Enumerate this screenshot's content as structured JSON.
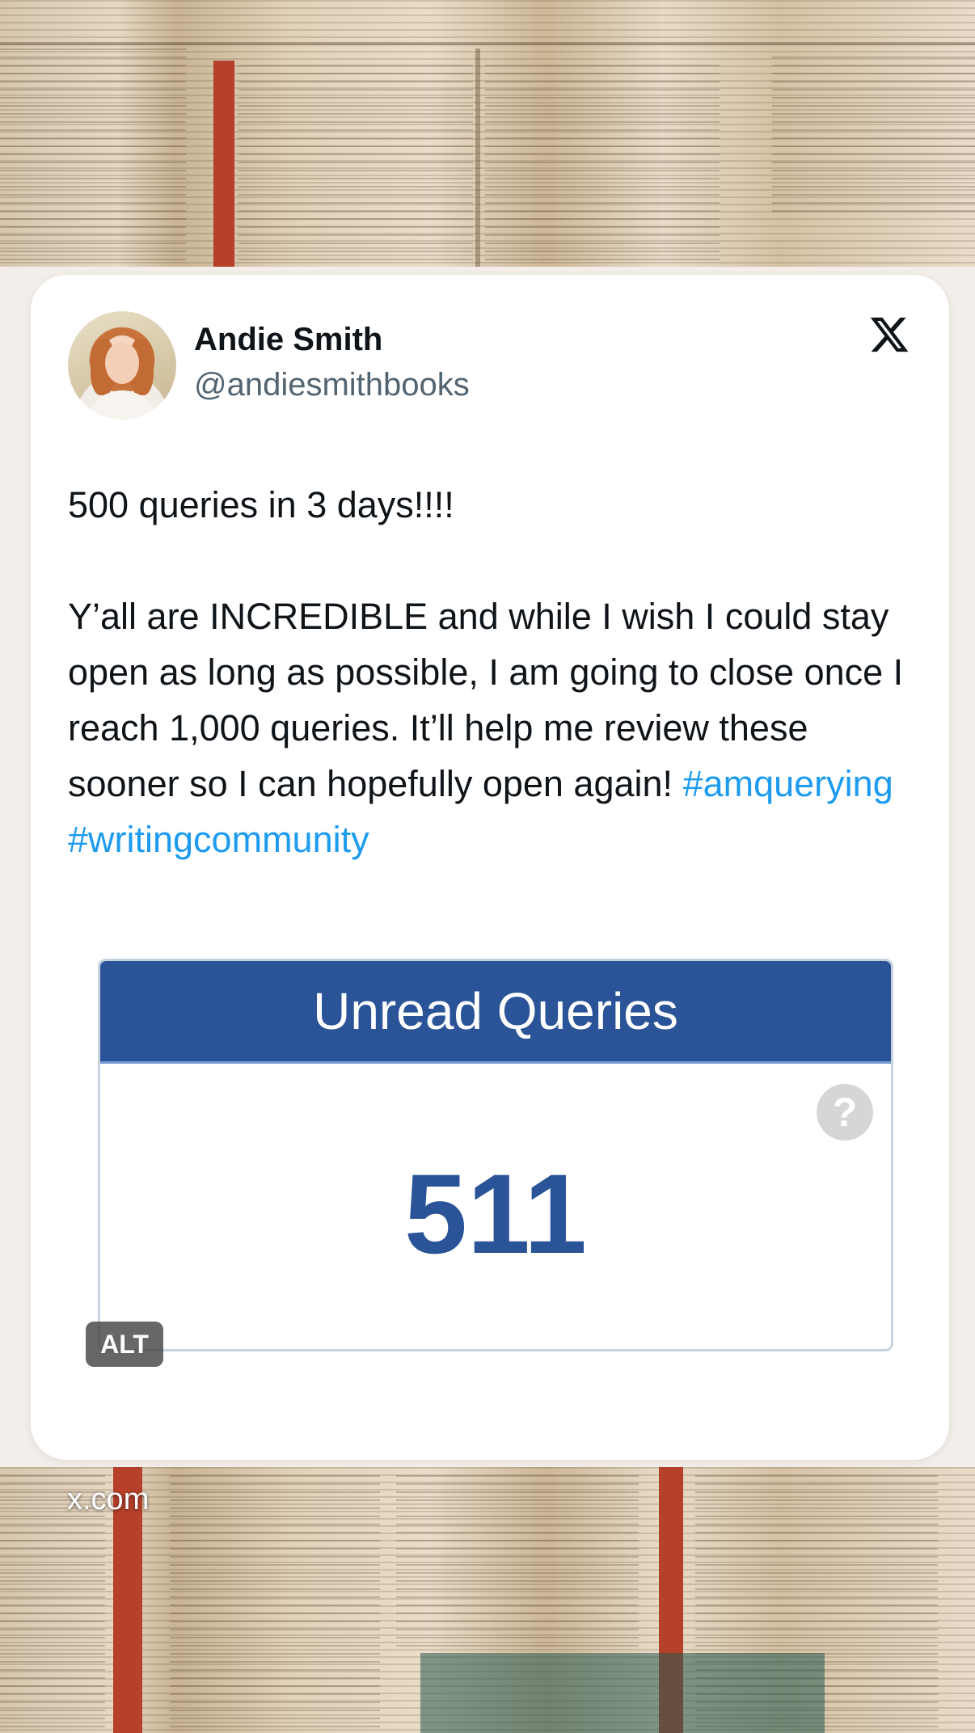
{
  "tweet": {
    "author_name": "Andie Smith",
    "handle": "@andiesmithbooks",
    "text_line1": "500 queries in 3 days!!!!",
    "text_body": "Y’all are INCREDIBLE and while I wish I could stay open as long as possible, I am going to close once I reach 1,000 queries. It’ll help me review these sooner so I can hopefully open again!",
    "hashtags": [
      "#amquerying",
      "#writingcommunity"
    ]
  },
  "media": {
    "header": "Unread Queries",
    "help_icon": "?",
    "count": "511",
    "alt_label": "ALT"
  },
  "footer": {
    "source": "x.com"
  },
  "icons": {
    "platform": "x-logo-icon",
    "help": "question-mark-icon"
  },
  "colors": {
    "header_blue": "#2a5497",
    "hashtag_blue": "#1d9bf0",
    "handle_gray": "#536471"
  }
}
